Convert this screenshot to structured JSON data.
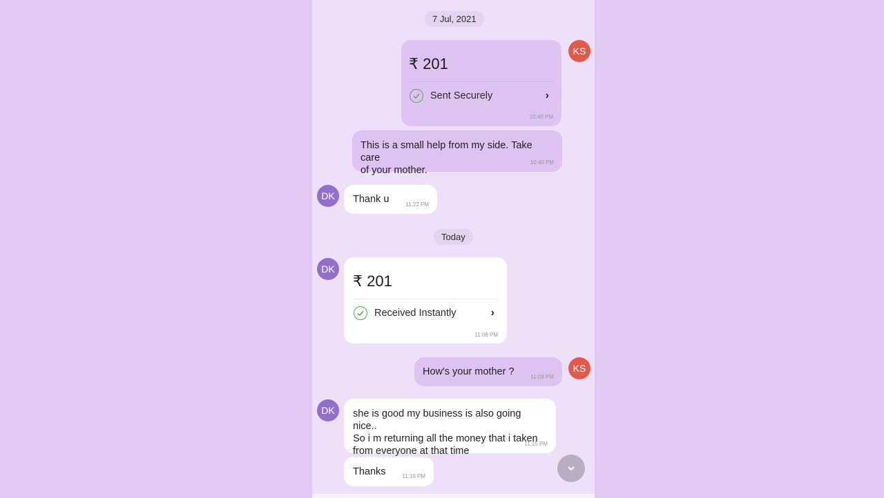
{
  "chat": {
    "date_chips": [
      "7 Jul, 2021",
      "Today"
    ],
    "avatars": {
      "self": "KS",
      "other": "DK"
    },
    "messages": [
      {
        "from": "self",
        "type": "payment",
        "amount": "₹ 201",
        "status": "Sent Securely",
        "time": "10:40 PM"
      },
      {
        "from": "self",
        "type": "text",
        "lines": [
          "This is a small help from my side. Take care",
          "of your mother."
        ],
        "time": "10:40 PM"
      },
      {
        "from": "other",
        "type": "text",
        "lines": [
          "Thank u"
        ],
        "time": "11:22 PM"
      },
      {
        "from": "other",
        "type": "payment",
        "amount": "₹ 201",
        "status": "Received Instantly",
        "time": "11:06 PM"
      },
      {
        "from": "self",
        "type": "text",
        "lines": [
          "How's your mother ?"
        ],
        "time": "11:09 PM"
      },
      {
        "from": "other",
        "type": "text",
        "lines": [
          "she is good my business is also going nice..",
          "So i m returning all the money that i taken",
          "from everyone at that time"
        ],
        "time": "11:15 PM"
      },
      {
        "from": "other",
        "type": "text",
        "lines": [
          "Thanks"
        ],
        "time": "11:19 PM"
      }
    ]
  },
  "icons": {
    "check": "check-circle-icon",
    "chevron": "chevron-right-icon",
    "scroll": "chevron-down-icon"
  },
  "colors": {
    "sent_bubble": "#dcc3f2",
    "received_bubble": "#ffffff",
    "avatar_self": "#e0594a",
    "avatar_other": "#9270c9",
    "check": "#5aa05a"
  }
}
